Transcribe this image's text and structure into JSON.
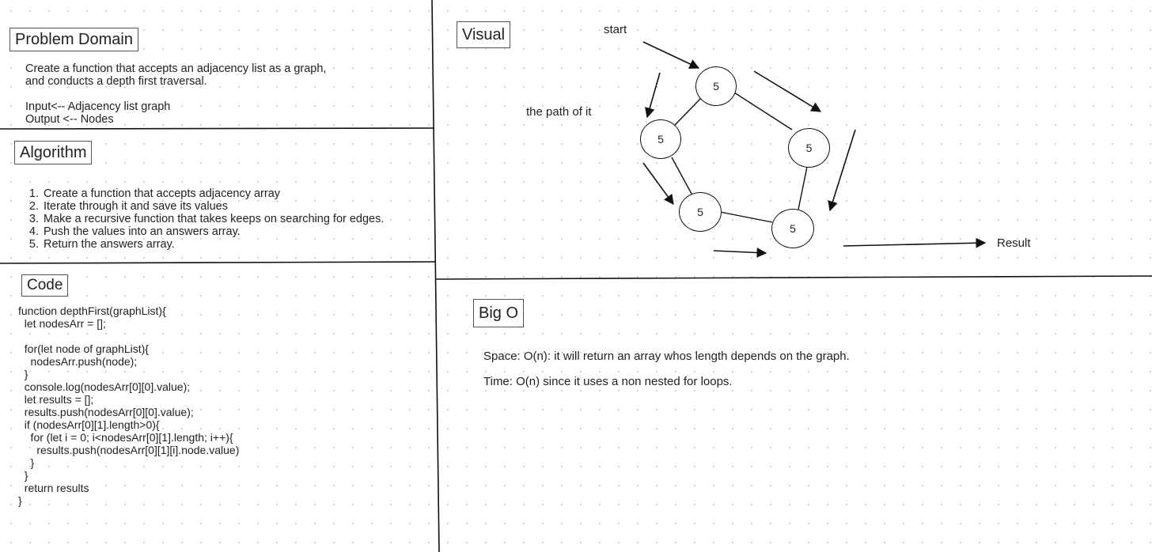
{
  "problem_domain": {
    "title": "Problem Domain",
    "description_line1": "Create a function that accepts an adjacency list as a graph,",
    "description_line2": "and conducts a depth first traversal.",
    "input": "Input<-- Adjacency list graph",
    "output": "Output <-- Nodes"
  },
  "algorithm": {
    "title": "Algorithm",
    "steps": [
      "Create a function that accepts adjacency array",
      "Iterate through it and save its values",
      "Make a recursive function that takes keeps on searching for edges.",
      "Push the values into an answers array.",
      "Return the answers array."
    ]
  },
  "code": {
    "title": "Code",
    "source": "function depthFirst(graphList){\n  let nodesArr = [];\n\n  for(let node of graphList){\n    nodesArr.push(node);\n  }\n  console.log(nodesArr[0][0].value);\n  let results = [];\n  results.push(nodesArr[0][0].value);\n  if (nodesArr[0][1].length>0){\n    for (let i = 0; i<nodesArr[0][1].length; i++){\n      results.push(nodesArr[0][1][i].node.value)\n    }\n  }\n  return results\n}"
  },
  "visual": {
    "title": "Visual",
    "start_label": "start",
    "path_label": "the path of it",
    "result_label": "Result",
    "nodes": [
      "5",
      "5",
      "5",
      "5",
      "5"
    ]
  },
  "big_o": {
    "title": "Big O",
    "space": "Space: O(n): it will return an array whos length depends on the graph.",
    "time": "Time: O(n) since it uses a non nested for loops."
  }
}
